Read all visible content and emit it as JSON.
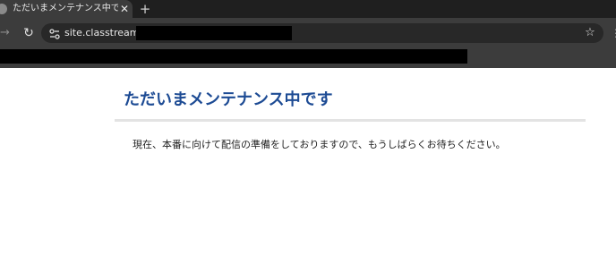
{
  "browser": {
    "tab": {
      "title": "ただいまメンテナンス中です | アイビー",
      "close_icon": "close-icon",
      "favicon_icon": "globe-icon"
    },
    "new_tab_icon": "plus-icon",
    "toolbar": {
      "forward_icon": "arrow-right-icon",
      "reload_icon": "reload-icon",
      "site_info_icon": "tune-icon",
      "url": "site.classtream.jp/v/",
      "bookmark_icon": "star-icon"
    }
  },
  "page": {
    "title": "ただいまメンテナンス中です",
    "message": "現在、本番に向けて配信の準備をしておりますので、もうしばらくお待ちください。",
    "title_color": "#1d4b94"
  }
}
